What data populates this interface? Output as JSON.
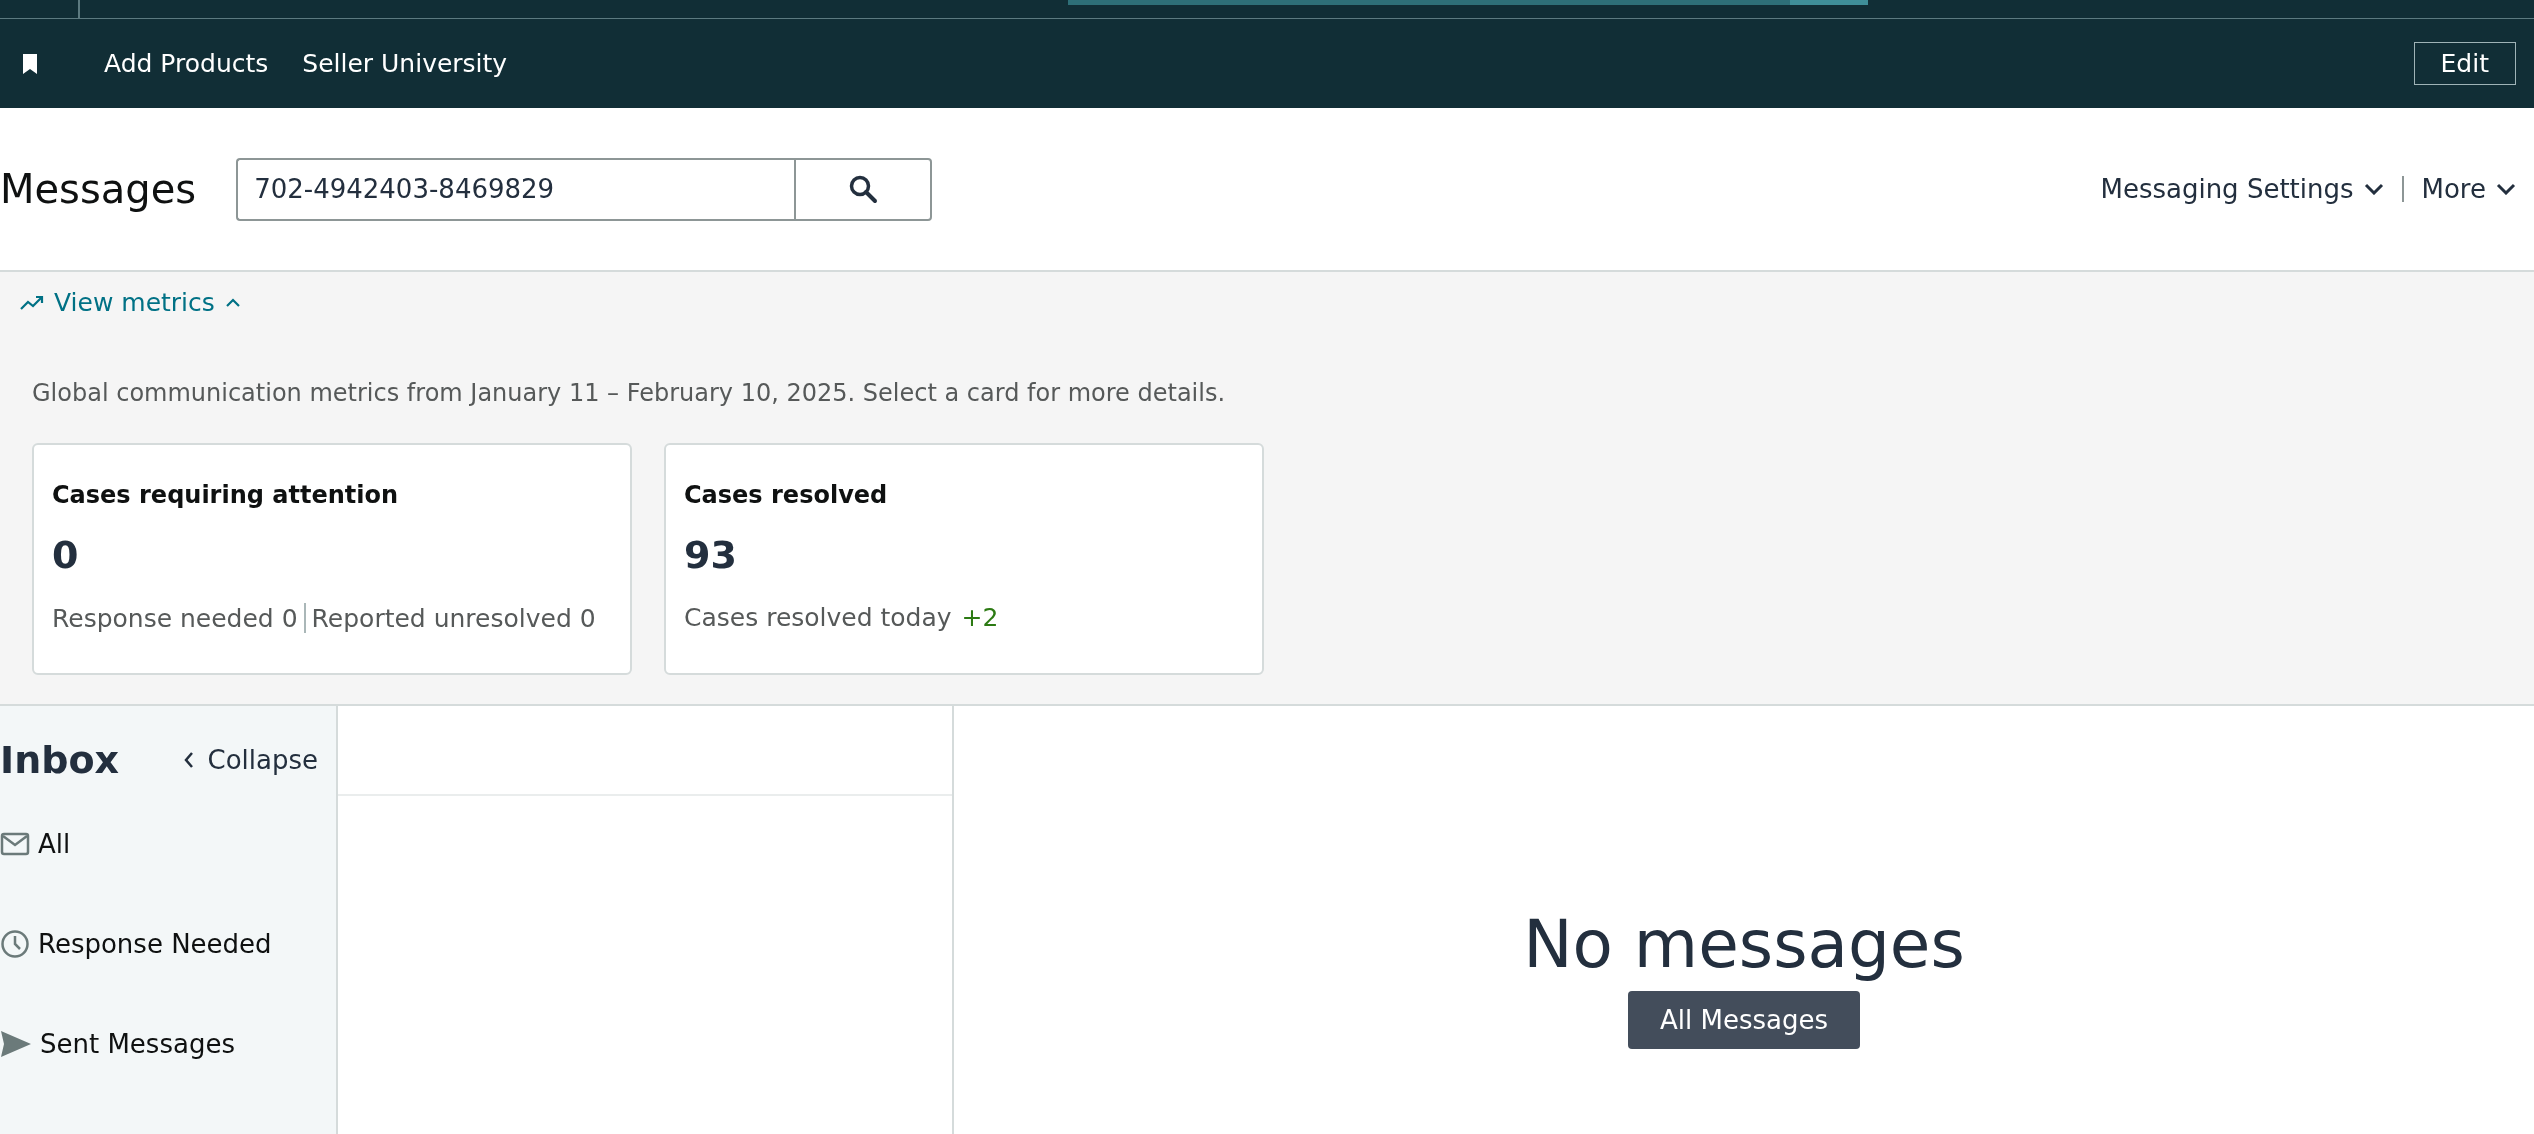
{
  "nav": {
    "links": [
      "Add Products",
      "Seller University"
    ],
    "edit_button": "Edit"
  },
  "header": {
    "title": "Messages",
    "search": {
      "value": "702-4942403-8469829"
    },
    "menus": [
      "Messaging Settings",
      "More"
    ]
  },
  "metrics": {
    "toggle": {
      "label": "View metrics",
      "expanded": true
    },
    "description": "Global communication metrics from January 11 – February 10, 2025. Select a card for more details.",
    "cards": [
      {
        "kind": "split",
        "title": "Cases requiring attention",
        "value": "0",
        "details": [
          "Response needed 0",
          "Reported unresolved 0"
        ]
      },
      {
        "kind": "delta",
        "title": "Cases resolved",
        "value": "93",
        "details": [
          "Cases resolved today"
        ],
        "delta": "+2"
      }
    ]
  },
  "inbox": {
    "title": "Inbox",
    "collapse": "Collapse",
    "items": [
      {
        "kind": "all",
        "label": "All"
      },
      {
        "kind": "response",
        "label": "Response Needed"
      },
      {
        "kind": "sent",
        "label": "Sent Messages"
      }
    ]
  },
  "empty_state": {
    "title": "No messages",
    "button": "All Messages"
  }
}
